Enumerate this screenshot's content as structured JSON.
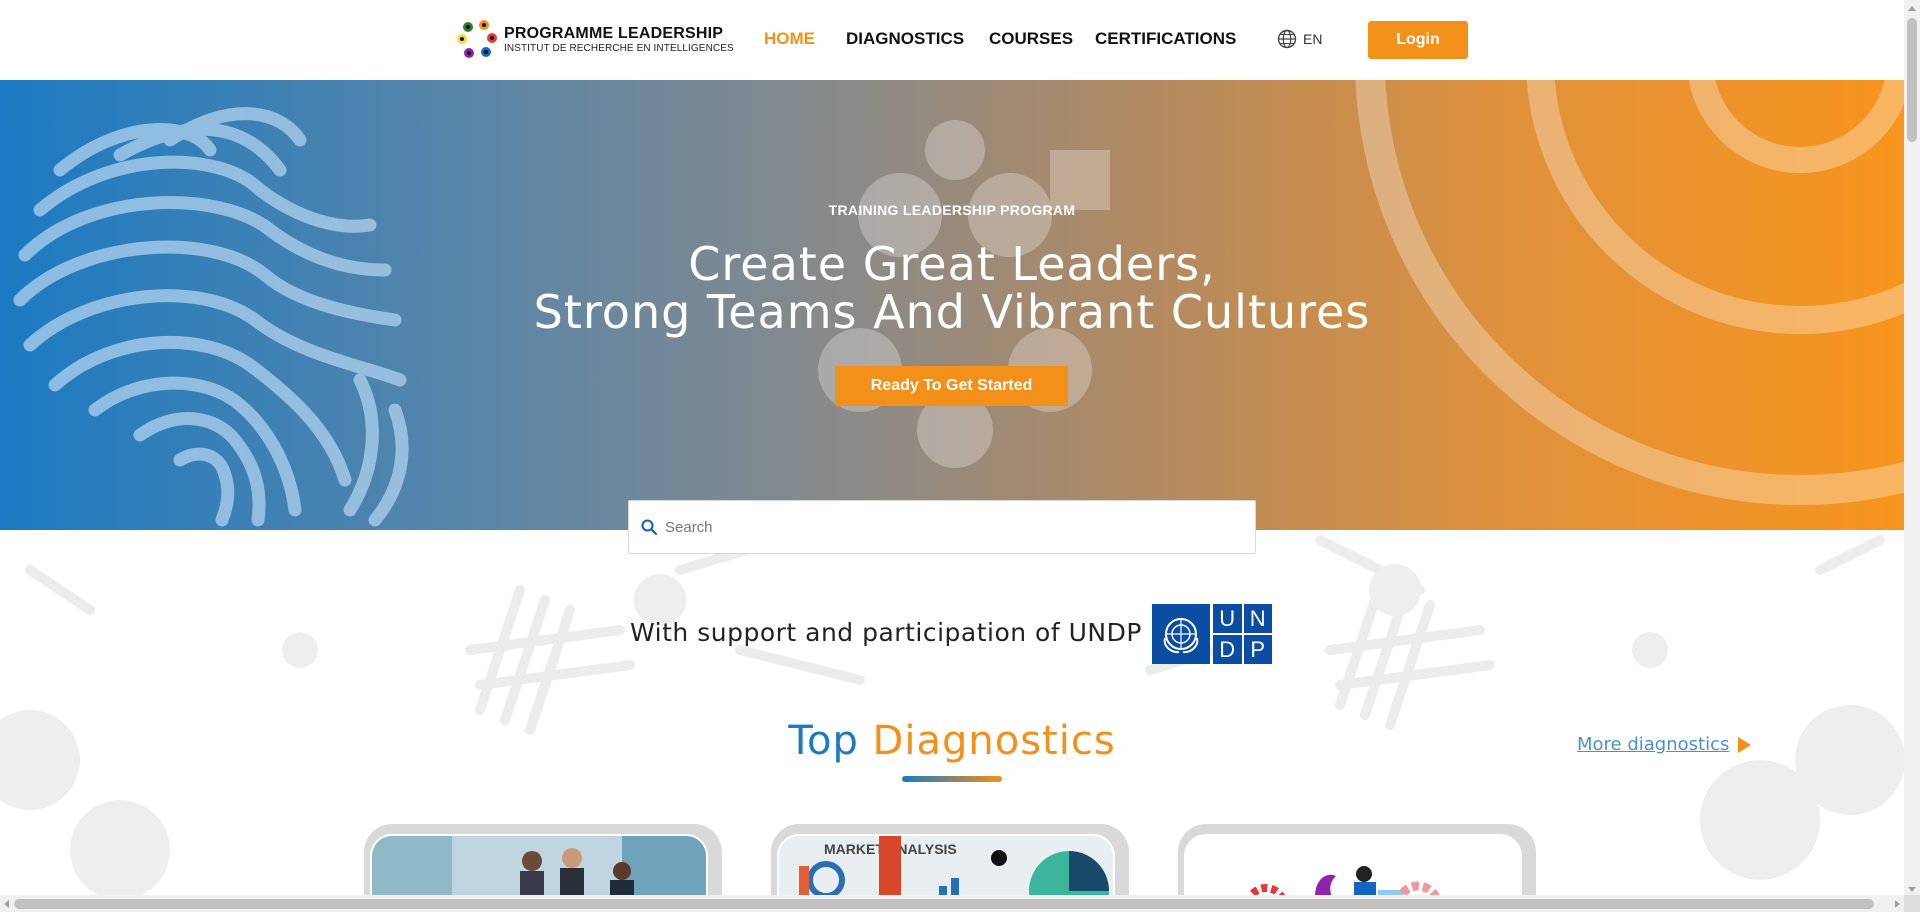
{
  "header": {
    "logo_title": "PROGRAMME LEADERSHIP",
    "logo_subtitle": "INSTITUT DE RECHERCHE EN INTELLIGENCES",
    "nav": [
      {
        "label": "HOME",
        "active": true
      },
      {
        "label": "DIAGNOSTICS",
        "active": false
      },
      {
        "label": "COURSES",
        "active": false
      },
      {
        "label": "CERTIFICATIONS",
        "active": false
      }
    ],
    "language": "EN",
    "login_label": "Login"
  },
  "hero": {
    "eyebrow": "TRAINING LEADERSHIP PROGRAM",
    "title_line1": "Create Great Leaders,",
    "title_line2": "Strong Teams And Vibrant Cultures",
    "cta_label": "Ready To Get Started"
  },
  "search": {
    "placeholder": "Search",
    "value": ""
  },
  "support": {
    "text": "With support and participation of UNDP",
    "logo_letters": [
      "U",
      "N",
      "D",
      "P"
    ]
  },
  "top_diagnostics": {
    "title_word1": "Top",
    "title_word2": "Diagnostics",
    "more_link": "More diagnostics",
    "card2_caption": "MARKET ANALYSIS"
  },
  "colors": {
    "accent_orange": "#f39019",
    "accent_blue": "#1b7ac2",
    "undp_blue": "#0a4da2"
  }
}
